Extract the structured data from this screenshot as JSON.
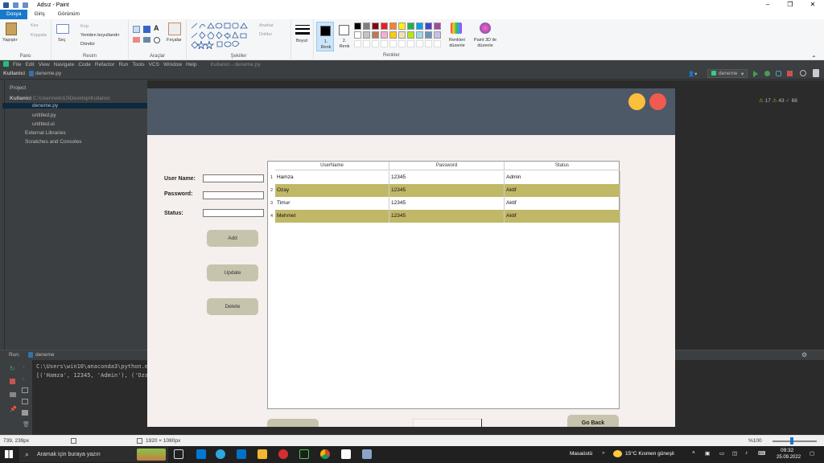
{
  "paint": {
    "window_title": "Adsız - Paint",
    "tabs": [
      "Dosya",
      "Giriş",
      "Görünüm"
    ],
    "groups": {
      "clipboard": {
        "paste": "Yapıştır",
        "cut": "Kes",
        "copy": "Kopyala",
        "label": "Pano"
      },
      "image": {
        "select": "Seç",
        "crop": "Kırp",
        "resize": "Yeniden boyutlandır",
        "rotate": "Döndür",
        "label": "Resim"
      },
      "tools": {
        "brushes": "Fırçalar",
        "label": "Araçlar"
      },
      "shapes": {
        "outline": "Anahat",
        "fill": "Doldur",
        "label": "Şekiller"
      },
      "size": {
        "label": "Boyut"
      },
      "colors": {
        "color1": "1. Renk",
        "color2": "2. Renk",
        "edit": "Renkleri düzenle",
        "paint3d": "Paint 3D ile düzenle",
        "label": "Renkler"
      }
    },
    "palette": [
      "#000000",
      "#7f7f7f",
      "#880015",
      "#ed1c24",
      "#ff7f27",
      "#fff200",
      "#22b14c",
      "#00a2e8",
      "#3f48cc",
      "#a349a4",
      "#ffffff",
      "#c3c3c3",
      "#b97a57",
      "#ffaec9",
      "#ffc90e",
      "#efe4b0",
      "#b5e61d",
      "#99d9ea",
      "#7092be",
      "#c8bfe7"
    ],
    "status": {
      "coords": "739, 239px",
      "canvas_size": "1920 × 1080px",
      "zoom": "%100"
    }
  },
  "ide": {
    "menu": [
      "File",
      "Edit",
      "View",
      "Navigate",
      "Code",
      "Refactor",
      "Run",
      "Tools",
      "VCS",
      "Window",
      "Help"
    ],
    "title": "Kullanici - deneme.py",
    "breadcrumb_project": "Kullanici",
    "breadcrumb_file": "deneme.py",
    "run_config": "deneme",
    "project_label": "Project",
    "inspections": {
      "warnings": "17",
      "weak": "43",
      "ok": "68"
    },
    "tree": {
      "root": "Kullanici",
      "root_path": "C:\\Users\\win10\\Desktop\\Kullanici",
      "files": [
        "deneme.py",
        "untitled.py",
        "untitled.ui"
      ],
      "external": "External Libraries",
      "scratches": "Scratches and Consoles"
    },
    "run": {
      "label": "Run:",
      "tab": "deneme",
      "line1": "C:\\Users\\win10\\anaconda3\\python.e",
      "line2": "[('Hamza', 12345, 'Admin'), ('Oza"
    }
  },
  "app": {
    "labels": {
      "username": "User Name:",
      "password": "Password:",
      "status": "Status:"
    },
    "buttons": {
      "add": "Add",
      "update": "Update",
      "delete": "Delete",
      "go_back": "Go Back"
    },
    "colors": {
      "header": "#4d5966",
      "yellow_dot": "#fbbf3b",
      "red_dot": "#f05a4f",
      "row_alt": "#c1b867",
      "button": "#c7c4ad",
      "background": "#f5efed"
    },
    "table": {
      "columns": [
        "UserName",
        "Password",
        "Status"
      ],
      "rows": [
        {
          "num": "1",
          "username": "Hamza",
          "password": "12345",
          "status": "Admin"
        },
        {
          "num": "2",
          "username": "Ozay",
          "password": "12345",
          "status": "Aktif"
        },
        {
          "num": "3",
          "username": "Timur",
          "password": "12345",
          "status": "Aktif"
        },
        {
          "num": "4",
          "username": "Mehmet",
          "password": "12345",
          "status": "Aktif"
        }
      ]
    }
  },
  "taskbar": {
    "search_placeholder": "Aramak için buraya yazın",
    "desktop": "Masaüstü",
    "weather": "15°C  Kısmen güneşli",
    "time": "09:32",
    "date": "25.09.2022"
  }
}
